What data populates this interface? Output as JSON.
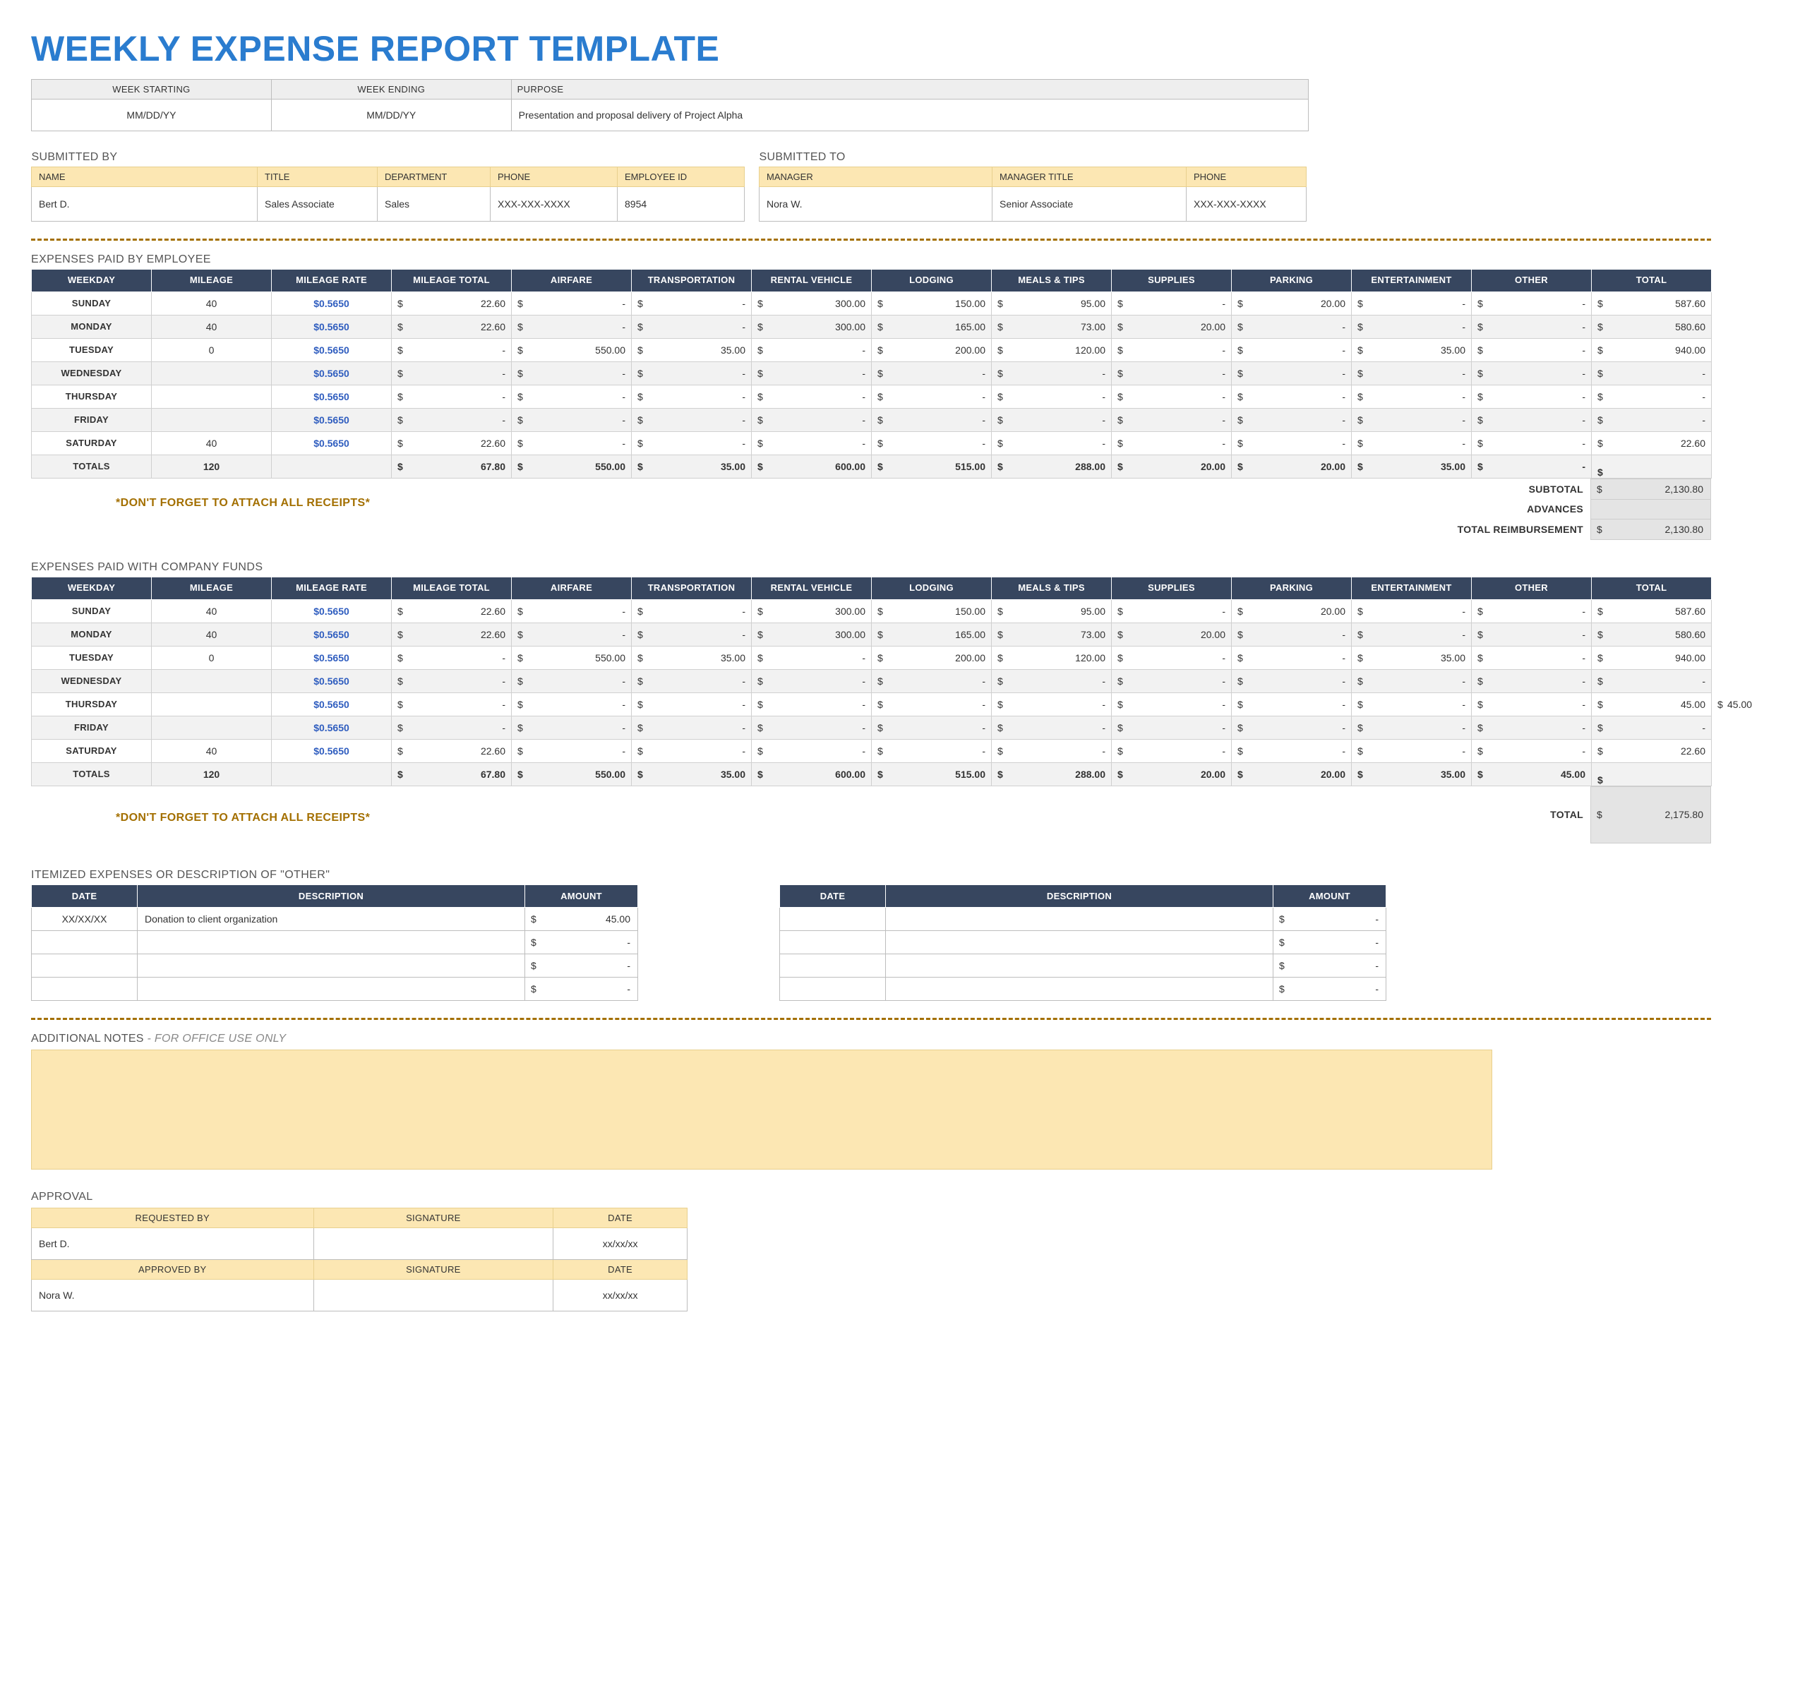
{
  "title": "WEEKLY EXPENSE REPORT TEMPLATE",
  "header": {
    "labels": {
      "week_starting": "WEEK STARTING",
      "week_ending": "WEEK ENDING",
      "purpose": "PURPOSE"
    },
    "week_starting": "MM/DD/YY",
    "week_ending": "MM/DD/YY",
    "purpose": "Presentation and proposal delivery of Project Alpha"
  },
  "submitted_by": {
    "title": "SUBMITTED BY",
    "labels": {
      "name": "NAME",
      "title": "TITLE",
      "department": "DEPARTMENT",
      "phone": "PHONE",
      "employee_id": "EMPLOYEE ID"
    },
    "name": "Bert D.",
    "role": "Sales Associate",
    "department": "Sales",
    "phone": "XXX-XXX-XXXX",
    "employee_id": "8954"
  },
  "submitted_to": {
    "title": "SUBMITTED TO",
    "labels": {
      "manager": "MANAGER",
      "manager_title": "MANAGER TITLE",
      "phone": "PHONE"
    },
    "manager": "Nora W.",
    "manager_title": "Senior Associate",
    "phone": "XXX-XXX-XXXX"
  },
  "receipts_note": "*DON'T FORGET TO ATTACH ALL RECEIPTS*",
  "exp_headers": [
    "WEEKDAY",
    "MILEAGE",
    "MILEAGE RATE",
    "MILEAGE TOTAL",
    "AIRFARE",
    "TRANSPORTATION",
    "RENTAL VEHICLE",
    "LODGING",
    "MEALS & TIPS",
    "SUPPLIES",
    "PARKING",
    "ENTERTAINMENT",
    "OTHER",
    "TOTAL"
  ],
  "employee_block": {
    "title": "EXPENSES PAID BY EMPLOYEE",
    "rows": [
      {
        "day": "SUNDAY",
        "mileage": "40",
        "rate": "$0.5650",
        "cells": [
          "22.60",
          "-",
          "-",
          "300.00",
          "150.00",
          "95.00",
          "-",
          "20.00",
          "-",
          "-",
          "587.60"
        ]
      },
      {
        "day": "MONDAY",
        "mileage": "40",
        "rate": "$0.5650",
        "cells": [
          "22.60",
          "-",
          "-",
          "300.00",
          "165.00",
          "73.00",
          "20.00",
          "-",
          "-",
          "-",
          "580.60"
        ]
      },
      {
        "day": "TUESDAY",
        "mileage": "0",
        "rate": "$0.5650",
        "cells": [
          "-",
          "550.00",
          "35.00",
          "-",
          "200.00",
          "120.00",
          "-",
          "-",
          "35.00",
          "-",
          "940.00"
        ]
      },
      {
        "day": "WEDNESDAY",
        "mileage": "",
        "rate": "$0.5650",
        "cells": [
          "-",
          "-",
          "-",
          "-",
          "-",
          "-",
          "-",
          "-",
          "-",
          "-",
          "-"
        ]
      },
      {
        "day": "THURSDAY",
        "mileage": "",
        "rate": "$0.5650",
        "cells": [
          "-",
          "-",
          "-",
          "-",
          "-",
          "-",
          "-",
          "-",
          "-",
          "-",
          "-"
        ]
      },
      {
        "day": "FRIDAY",
        "mileage": "",
        "rate": "$0.5650",
        "cells": [
          "-",
          "-",
          "-",
          "-",
          "-",
          "-",
          "-",
          "-",
          "-",
          "-",
          "-"
        ]
      },
      {
        "day": "SATURDAY",
        "mileage": "40",
        "rate": "$0.5650",
        "cells": [
          "22.60",
          "-",
          "-",
          "-",
          "-",
          "-",
          "-",
          "-",
          "-",
          "-",
          "22.60"
        ]
      }
    ],
    "totals": {
      "label": "TOTALS",
      "mileage": "120",
      "cells": [
        "67.80",
        "550.00",
        "35.00",
        "600.00",
        "515.00",
        "288.00",
        "20.00",
        "20.00",
        "35.00",
        "-",
        ""
      ]
    },
    "summary": {
      "subtotal_label": "SUBTOTAL",
      "subtotal": "2,130.80",
      "advances_label": "ADVANCES",
      "advances": "",
      "total_label": "TOTAL REIMBURSEMENT",
      "total": "2,130.80"
    }
  },
  "company_block": {
    "title": "EXPENSES PAID WITH COMPANY FUNDS",
    "rows": [
      {
        "day": "SUNDAY",
        "mileage": "40",
        "rate": "$0.5650",
        "cells": [
          "22.60",
          "-",
          "-",
          "300.00",
          "150.00",
          "95.00",
          "-",
          "20.00",
          "-",
          "-",
          "587.60"
        ]
      },
      {
        "day": "MONDAY",
        "mileage": "40",
        "rate": "$0.5650",
        "cells": [
          "22.60",
          "-",
          "-",
          "300.00",
          "165.00",
          "73.00",
          "20.00",
          "-",
          "-",
          "-",
          "580.60"
        ]
      },
      {
        "day": "TUESDAY",
        "mileage": "0",
        "rate": "$0.5650",
        "cells": [
          "-",
          "550.00",
          "35.00",
          "-",
          "200.00",
          "120.00",
          "-",
          "-",
          "35.00",
          "-",
          "940.00"
        ]
      },
      {
        "day": "WEDNESDAY",
        "mileage": "",
        "rate": "$0.5650",
        "cells": [
          "-",
          "-",
          "-",
          "-",
          "-",
          "-",
          "-",
          "-",
          "-",
          "-",
          "-"
        ]
      },
      {
        "day": "THURSDAY",
        "mileage": "",
        "rate": "$0.5650",
        "cells": [
          "-",
          "-",
          "-",
          "-",
          "-",
          "-",
          "-",
          "-",
          "-",
          "-",
          "45.00",
          "45.00"
        ]
      },
      {
        "day": "FRIDAY",
        "mileage": "",
        "rate": "$0.5650",
        "cells": [
          "-",
          "-",
          "-",
          "-",
          "-",
          "-",
          "-",
          "-",
          "-",
          "-",
          "-"
        ]
      },
      {
        "day": "SATURDAY",
        "mileage": "40",
        "rate": "$0.5650",
        "cells": [
          "22.60",
          "-",
          "-",
          "-",
          "-",
          "-",
          "-",
          "-",
          "-",
          "-",
          "22.60"
        ]
      }
    ],
    "totals": {
      "label": "TOTALS",
      "mileage": "120",
      "cells": [
        "67.80",
        "550.00",
        "35.00",
        "600.00",
        "515.00",
        "288.00",
        "20.00",
        "20.00",
        "35.00",
        "45.00",
        ""
      ]
    },
    "summary": {
      "total_label": "TOTAL",
      "total": "2,175.80"
    }
  },
  "itemized": {
    "title": "ITEMIZED EXPENSES OR DESCRIPTION OF \"OTHER\"",
    "headers": {
      "date": "DATE",
      "desc": "DESCRIPTION",
      "amount": "AMOUNT"
    },
    "left": [
      {
        "date": "XX/XX/XX",
        "desc": "Donation to client organization",
        "amount": "45.00"
      },
      {
        "date": "",
        "desc": "",
        "amount": "-"
      },
      {
        "date": "",
        "desc": "",
        "amount": "-"
      },
      {
        "date": "",
        "desc": "",
        "amount": "-"
      }
    ],
    "right": [
      {
        "date": "",
        "desc": "",
        "amount": "-"
      },
      {
        "date": "",
        "desc": "",
        "amount": "-"
      },
      {
        "date": "",
        "desc": "",
        "amount": "-"
      },
      {
        "date": "",
        "desc": "",
        "amount": "-"
      }
    ]
  },
  "notes": {
    "title": "ADDITIONAL NOTES",
    "suffix": " - FOR OFFICE USE ONLY"
  },
  "approval": {
    "title": "APPROVAL",
    "labels": {
      "requested_by": "REQUESTED BY",
      "approved_by": "APPROVED BY",
      "signature": "SIGNATURE",
      "date": "DATE"
    },
    "requested_by": "Bert D.",
    "requested_date": "xx/xx/xx",
    "approved_by": "Nora W.",
    "approved_date": "xx/xx/xx"
  }
}
